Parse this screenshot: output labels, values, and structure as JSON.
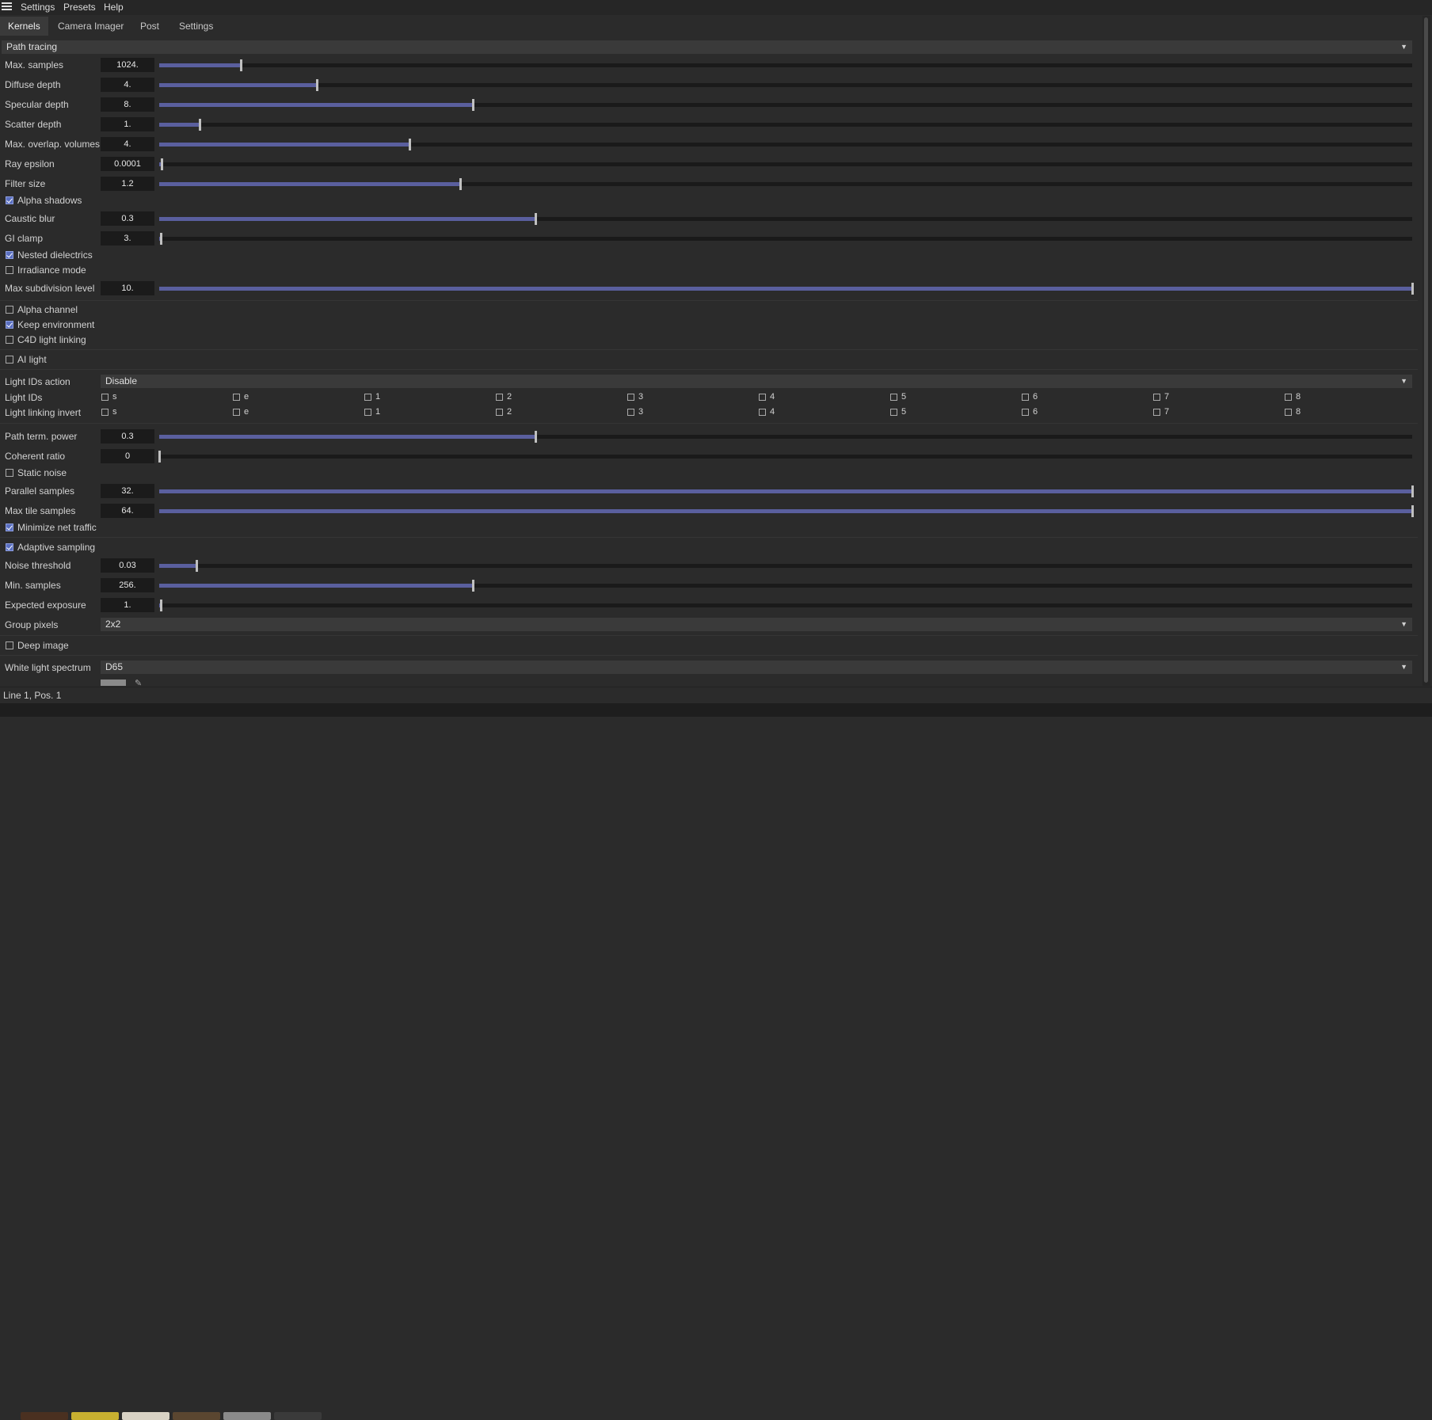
{
  "menu": {
    "items": [
      "Settings",
      "Presets",
      "Help"
    ]
  },
  "tabs": [
    "Kernels",
    "Camera Imager",
    "Post",
    "Settings"
  ],
  "kernel_type": "Path tracing",
  "sliders1": [
    {
      "label": "Max. samples",
      "value": "1024.",
      "fill": 0.065
    },
    {
      "label": "Diffuse depth",
      "value": "4.",
      "fill": 0.126
    },
    {
      "label": "Specular depth",
      "value": "8.",
      "fill": 0.25
    },
    {
      "label": "Scatter depth",
      "value": "1.",
      "fill": 0.032
    },
    {
      "label": "Max. overlap. volumes",
      "value": "4.",
      "fill": 0.2
    },
    {
      "label": "Ray epsilon",
      "value": "0.0001",
      "fill": 0.002
    },
    {
      "label": "Filter size",
      "value": "1.2",
      "fill": 0.24
    }
  ],
  "alpha_shadows": {
    "label": "Alpha shadows",
    "checked": true
  },
  "caustic_blur": {
    "label": "Caustic blur",
    "value": "0.3",
    "fill": 0.3
  },
  "gi_clamp": {
    "label": "GI clamp",
    "value": "3.",
    "fill": 0.001
  },
  "nested_dielectrics": {
    "label": "Nested dielectrics",
    "checked": true
  },
  "irradiance_mode": {
    "label": "Irradiance mode",
    "checked": false
  },
  "max_subdivision": {
    "label": "Max subdivision level",
    "value": "10.",
    "fill": 1.0
  },
  "alpha_channel": {
    "label": "Alpha channel",
    "checked": false
  },
  "keep_environment": {
    "label": "Keep environment",
    "checked": true
  },
  "c4d_light_linking": {
    "label": "C4D light linking",
    "checked": false
  },
  "ai_light": {
    "label": "AI light",
    "checked": false
  },
  "light_ids_action": {
    "label": "Light IDs action",
    "value": "Disable"
  },
  "light_ids": {
    "label": "Light IDs",
    "items": [
      "s",
      "e",
      "1",
      "2",
      "3",
      "4",
      "5",
      "6",
      "7",
      "8"
    ]
  },
  "light_linking_invert": {
    "label": "Light linking invert",
    "items": [
      "s",
      "e",
      "1",
      "2",
      "3",
      "4",
      "5",
      "6",
      "7",
      "8"
    ]
  },
  "path_term_power": {
    "label": "Path term. power",
    "value": "0.3",
    "fill": 0.3
  },
  "coherent_ratio": {
    "label": "Coherent ratio",
    "value": "0",
    "fill": 0.0
  },
  "static_noise": {
    "label": "Static noise",
    "checked": false
  },
  "parallel_samples": {
    "label": "Parallel samples",
    "value": "32.",
    "fill": 1.0
  },
  "max_tile_samples": {
    "label": "Max tile samples",
    "value": "64.",
    "fill": 1.0
  },
  "minimize_net_traffic": {
    "label": "Minimize net traffic",
    "checked": true
  },
  "adaptive_sampling": {
    "label": "Adaptive sampling",
    "checked": true
  },
  "noise_threshold": {
    "label": "Noise threshold",
    "value": "0.03",
    "fill": 0.03
  },
  "min_samples": {
    "label": "Min. samples",
    "value": "256.",
    "fill": 0.25
  },
  "expected_exposure": {
    "label": "Expected exposure",
    "value": "1.",
    "fill": 0.001
  },
  "group_pixels": {
    "label": "Group pixels",
    "value": "2x2"
  },
  "deep_image": {
    "label": "Deep image",
    "checked": false
  },
  "white_light_spectrum": {
    "label": "White light spectrum",
    "value": "D65"
  },
  "status": {
    "text": "Line 1, Pos. 1"
  },
  "colors": {
    "accent": "#5a5f9e",
    "background": "#2b2b2b",
    "field": "#1b1b1b"
  }
}
